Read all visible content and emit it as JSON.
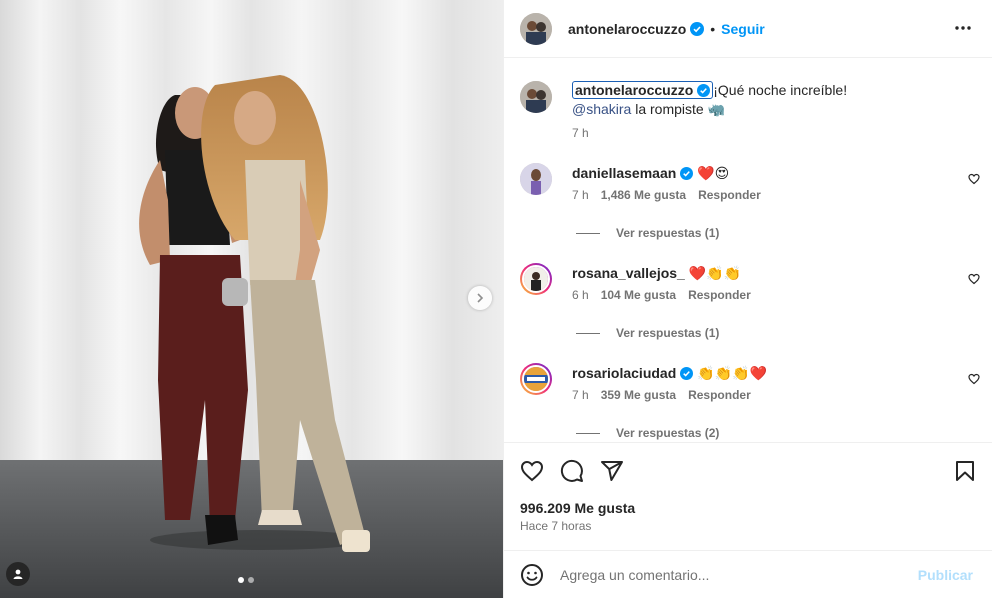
{
  "header": {
    "username": "antonelaroccuzzo",
    "bullet": "•",
    "follow_label": "Seguir"
  },
  "caption": {
    "username": "antonelaroccuzzo",
    "text": "¡Qué noche increíble!",
    "mention": "@shakira",
    "text2": "la rompiste",
    "emoji2": "🦏",
    "time": "7 h"
  },
  "comments": [
    {
      "username": "daniellasemaan",
      "verified": true,
      "text": "❤️😍",
      "time": "7 h",
      "likes": "1,486 Me gusta",
      "reply": "Responder",
      "view_replies": "Ver respuestas (1)"
    },
    {
      "username": "rosana_vallejos_",
      "verified": false,
      "text": "❤️👏👏",
      "time": "6 h",
      "likes": "104 Me gusta",
      "reply": "Responder",
      "view_replies": "Ver respuestas (1)"
    },
    {
      "username": "rosariolaciudad",
      "verified": true,
      "text": "👏👏👏❤️",
      "time": "7 h",
      "likes": "359 Me gusta",
      "reply": "Responder",
      "view_replies": "Ver respuestas (2)"
    }
  ],
  "footer": {
    "likes": "996.209 Me gusta",
    "time_ago": "Hace 7 horas"
  },
  "composer": {
    "placeholder": "Agrega un comentario...",
    "post_label": "Publicar"
  },
  "colors": {
    "accent": "#0095f6",
    "verified": "#0095f6",
    "post_disabled": "#b2dffc"
  },
  "icons": [
    "chevron-right-icon",
    "user-tag-icon",
    "verified-icon",
    "more-icon",
    "heart-icon",
    "comment-icon",
    "share-icon",
    "bookmark-icon",
    "emoji-icon"
  ]
}
